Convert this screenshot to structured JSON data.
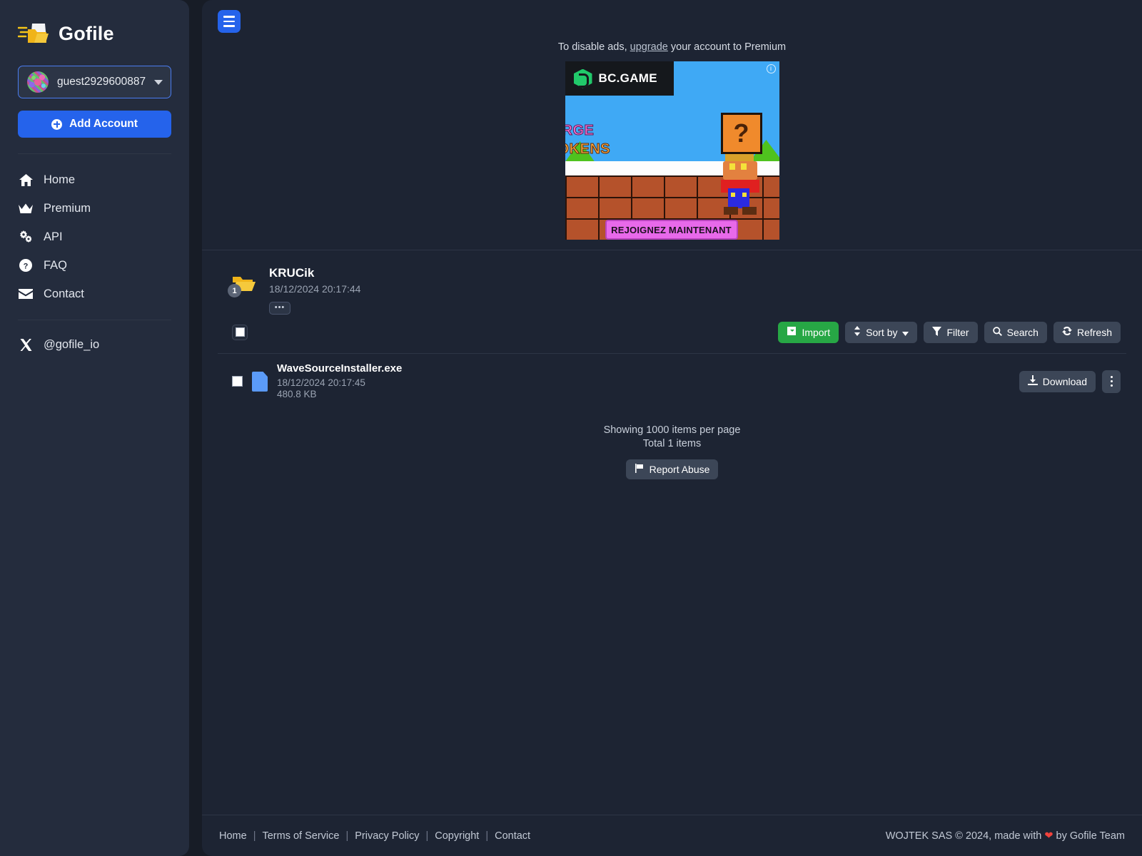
{
  "sidebar": {
    "brand": "Gofile",
    "brand_logo_icon": "gofile-folder-logo",
    "account": {
      "name": "guest2929600887",
      "avatar_icon": "identicon-avatar",
      "caret_icon": "chevron-down-icon"
    },
    "add_account_label": "Add Account",
    "nav": [
      {
        "label": "Home",
        "icon": "home-icon"
      },
      {
        "label": "Premium",
        "icon": "crown-icon"
      },
      {
        "label": "API",
        "icon": "gears-icon"
      },
      {
        "label": "FAQ",
        "icon": "question-circle-icon"
      },
      {
        "label": "Contact",
        "icon": "envelope-icon"
      }
    ],
    "social": {
      "label": "@gofile_io",
      "icon": "x-twitter-icon"
    }
  },
  "topbar": {
    "menu_icon": "hamburger-icon"
  },
  "ad": {
    "notice_prefix": "To disable ads,",
    "notice_link": "upgrade",
    "notice_suffix": "your account to Premium",
    "brand": "BC.GAME",
    "headline_line1": "RGE",
    "headline_line2": "OKENS",
    "qbox": "?",
    "cta": "REJOIGNEZ MAINTENANT",
    "adchoices_icon": "adchoices-icon"
  },
  "folder": {
    "name": "KRUCik",
    "date": "18/12/2024 20:17:44",
    "badge_count": "1",
    "more_label": "•••",
    "folder_icon": "folder-open-icon"
  },
  "toolbar": {
    "select_all_icon": "checkbox-icon",
    "buttons": [
      {
        "label": "Import",
        "icon": "import-icon",
        "style": "green"
      },
      {
        "label": "Sort by",
        "icon": "sort-icon",
        "style": "gray",
        "caret": true
      },
      {
        "label": "Filter",
        "icon": "funnel-icon",
        "style": "gray"
      },
      {
        "label": "Search",
        "icon": "search-icon",
        "style": "gray"
      },
      {
        "label": "Refresh",
        "icon": "refresh-icon",
        "style": "gray"
      }
    ]
  },
  "files": [
    {
      "name": "WaveSourceInstaller.exe",
      "date": "18/12/2024 20:17:45",
      "size": "480.8 KB",
      "icon": "file-icon",
      "download_label": "Download",
      "download_icon": "download-icon",
      "menu_icon": "kebab-menu-icon"
    }
  ],
  "pager": {
    "per_page": "Showing 1000 items per page",
    "total": "Total 1 items",
    "report_label": "Report Abuse",
    "report_icon": "flag-icon"
  },
  "footer": {
    "links": [
      "Home",
      "Terms of Service",
      "Privacy Policy",
      "Copyright",
      "Contact"
    ],
    "sep": "|",
    "copy_prefix": "WOJTEK SAS © 2024, made with",
    "heart": "❤",
    "copy_suffix": "by Gofile Team"
  },
  "colors": {
    "accent": "#2563eb",
    "green": "#27a745",
    "panel": "#1d2433",
    "sidebar": "#242c3d"
  }
}
